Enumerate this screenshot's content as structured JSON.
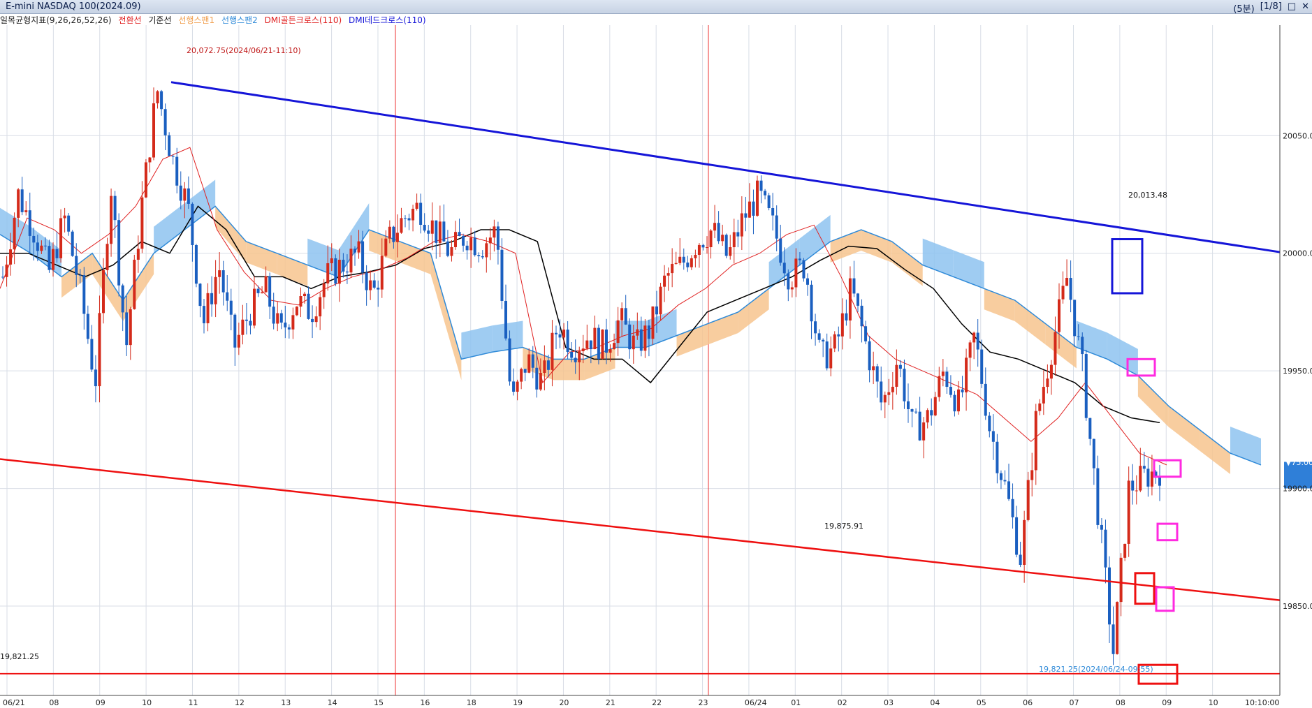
{
  "window": {
    "title": "E-mini NASDAQ 100(2024.09)",
    "period": "(5분)",
    "page": "[1/8]",
    "ctrl_restore": "□",
    "ctrl_close": "✕"
  },
  "legend": {
    "indicator": "일목균형지표(9,26,26,52,26)",
    "conversion": "전환선",
    "base": "기준선",
    "span1": "선행스팬1",
    "span2": "선행스팬2",
    "golden": "DMI골든크로스(110)",
    "dead": "DMI데드크로스(110)"
  },
  "colors": {
    "up": "#d42a1a",
    "down": "#1a5fc0",
    "span1_cloud": "#f7c48e",
    "span2_cloud": "#8ec3f0",
    "span_line": "#2f8ad8",
    "conversion": "#e02020",
    "base": "#000000",
    "trend_blue": "#1515d8",
    "trend_red": "#ee1010",
    "magenta": "#ff2ae0"
  },
  "chart_data": {
    "type": "candlestick",
    "title": "E-mini NASDAQ 100(2024.09)",
    "interval": "5분",
    "y_axis_ticks": [
      "20050.00",
      "20000.00",
      "19950.00",
      "19900.00",
      "19850.00"
    ],
    "y_axis_ticks_values": [
      20050,
      20000,
      19950,
      19900,
      19850
    ],
    "ylim": [
      19812,
      20097
    ],
    "x_axis_labels": [
      "06/21",
      "08",
      "09",
      "10",
      "11",
      "12",
      "13",
      "14",
      "15",
      "16",
      "18",
      "19",
      "20",
      "21",
      "22",
      "23",
      "06/24",
      "01",
      "02",
      "03",
      "04",
      "05",
      "06",
      "07",
      "08",
      "09",
      "10",
      "10:10:00"
    ],
    "annotations": {
      "high": "20,072.75(2024/06/21-11:10)",
      "low": "19,821.25(2024/06/24-09:55)",
      "upper_trend_value": "20,013.48",
      "lower_trend_value": "19,875.91",
      "left_level": "19,821.25"
    },
    "current": {
      "price": "19907.75",
      "change_pct": "-0.38%",
      "change": "▼75.00"
    },
    "series": [
      {
        "name": "전환선"
      },
      {
        "name": "기준선"
      },
      {
        "name": "선행스팬1"
      },
      {
        "name": "선행스팬2"
      }
    ],
    "close_path": [
      19990,
      20025,
      20010,
      19992,
      20015,
      19985,
      19945,
      20030,
      19960,
      20020,
      20070,
      20040,
      20020,
      19970,
      19995,
      19960,
      19975,
      19985,
      19965,
      19980,
      19975,
      19990,
      19995,
      20000,
      19982,
      20005,
      20015,
      20020,
      20010,
      20000,
      20008,
      20003,
      20010,
      19935,
      19955,
      19945,
      19970,
      19960,
      19965,
      19960,
      19972,
      19960,
      19968,
      19990,
      19995,
      20005,
      20010,
      19998,
      20015,
      20025,
      20010,
      19990,
      19995,
      19955,
      19960,
      19985,
      19960,
      19935,
      19955,
      19925,
      19930,
      19950,
      19935,
      19965,
      19925,
      19900,
      19870,
      19930,
      19960,
      19990,
      19950,
      19890,
      19830,
      19900,
      19905,
      19908
    ],
    "conversion_path": [
      19985,
      20015,
      20010,
      20000,
      20008,
      20020,
      20040,
      20045,
      20010,
      19992,
      19980,
      19978,
      19985,
      19990,
      19993,
      19998,
      20005,
      20008,
      20005,
      20000,
      19945,
      19958,
      19960,
      19965,
      19968,
      19978,
      19985,
      19995,
      20000,
      20008,
      20012,
      19990,
      19965,
      19955,
      19950,
      19945,
      19940,
      19930,
      19920,
      19930,
      19945,
      19930,
      19915,
      19910
    ],
    "base_path": [
      20000,
      20000,
      19995,
      19990,
      19995,
      20005,
      20000,
      20020,
      20010,
      19990,
      19990,
      19985,
      19990,
      19992,
      19995,
      20002,
      20005,
      20010,
      20010,
      20005,
      19960,
      19955,
      19955,
      19945,
      19960,
      19975,
      19980,
      19985,
      19990,
      19997,
      20003,
      20002,
      19993,
      19985,
      19970,
      19958,
      19955,
      19950,
      19945,
      19935,
      19930,
      19928
    ],
    "cloud_path": [
      20008,
      20000,
      19990,
      20000,
      19980,
      20000,
      20010,
      20020,
      20005,
      20000,
      19995,
      19990,
      20010,
      20005,
      20000,
      19955,
      19958,
      19960,
      19955,
      19955,
      19960,
      19960,
      19965,
      19970,
      19975,
      19985,
      19995,
      20005,
      20010,
      20005,
      19995,
      19990,
      19985,
      19980,
      19970,
      19960,
      19955,
      19948,
      19935,
      19925,
      19915,
      19910
    ]
  }
}
